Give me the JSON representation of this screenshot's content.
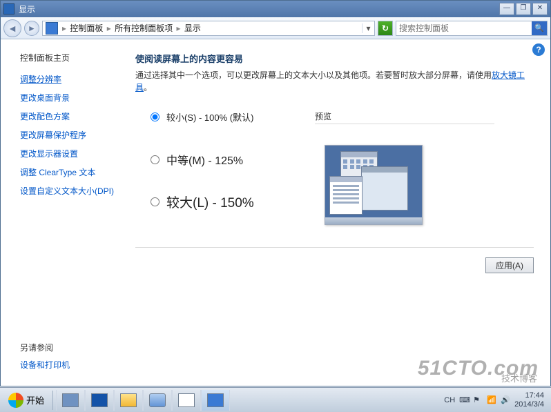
{
  "titlebar": {
    "title": "显示"
  },
  "nav": {
    "breadcrumb": {
      "p1": "控制面板",
      "p2": "所有控制面板项",
      "p3": "显示"
    },
    "search_placeholder": "搜索控制面板"
  },
  "sidebar": {
    "home": "控制面板主页",
    "links": {
      "resolution": "调整分辨率",
      "wallpaper": "更改桌面背景",
      "scheme": "更改配色方案",
      "screensaver": "更改屏幕保护程序",
      "monitor": "更改显示器设置",
      "cleartype": "调整 ClearType 文本",
      "dpi": "设置自定义文本大小(DPI)"
    },
    "seealso_h": "另请参阅",
    "seealso_link": "设备和打印机"
  },
  "main": {
    "heading": "使阅读屏幕上的内容更容易",
    "desc_a": "通过选择其中一个选项，可以更改屏幕上的文本大小以及其他项。若要暂时放大部分屏幕，请使用",
    "desc_link": "放大镜工具",
    "desc_b": "。",
    "radios": {
      "small": "较小(S) - 100% (默认)",
      "medium": "中等(M) - 125%",
      "large": "较大(L) - 150%"
    },
    "preview_label": "预览",
    "apply": "应用(A)"
  },
  "taskbar": {
    "start": "开始",
    "ime": "CH",
    "time": "17:44",
    "date": "2014/3/4"
  },
  "watermark": {
    "main": "51CTO.com",
    "sub": "技术博客"
  }
}
